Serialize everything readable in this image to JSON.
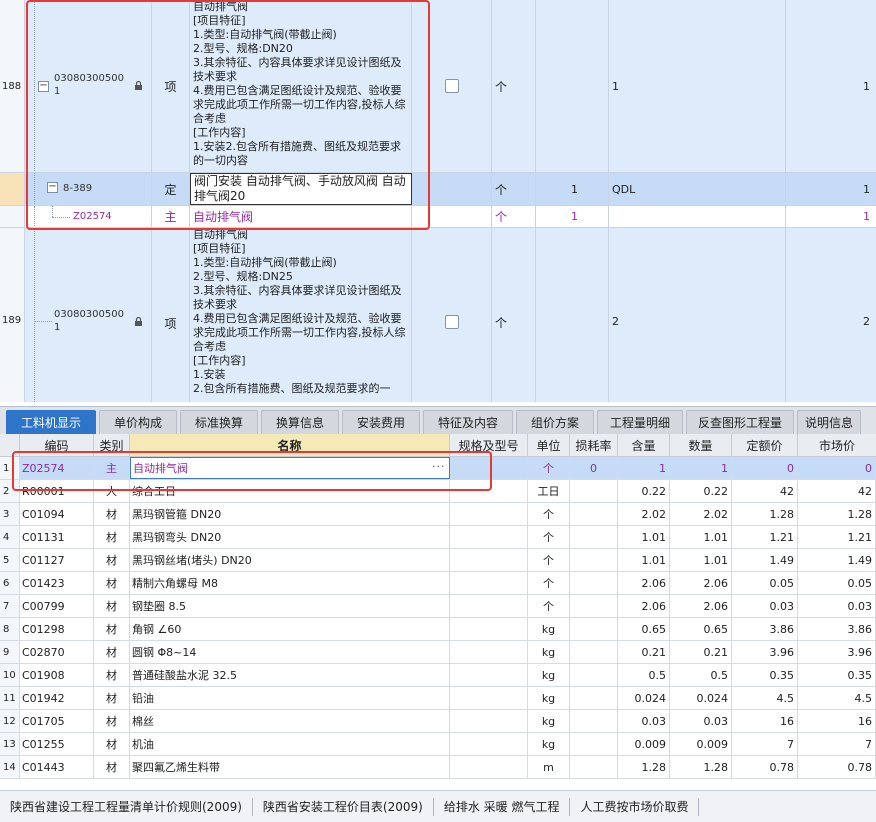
{
  "top_grid": {
    "rows": [
      {
        "num": "188",
        "code_line1": "03080300500",
        "code_line2": "1",
        "type": "项",
        "desc": "自动排气阀\n[项目特征]\n1.类型:自动排气阀(带截止阀)\n2.型号、规格:DN20\n3.其余特征、内容具体要求详见设计图纸及技术要求\n4.费用已包含满足图纸设计及规范、验收要求完成此项工作所需一切工作内容,投标人综合考虑\n[工作内容]\n1.安装2.包含所有措施费、图纸及规范要求的一切内容",
        "unit": "个",
        "qty": "",
        "expr": "1",
        "val": "1"
      },
      {
        "num": "",
        "code": "8-389",
        "type": "定",
        "desc": "阀门安装 自动排气阀、手动放风阀 自动排气阀20",
        "unit": "个",
        "qty": "1",
        "expr": "QDL",
        "val": "1"
      },
      {
        "num": "",
        "code": "Z02574",
        "type": "主",
        "desc": "自动排气阀",
        "unit": "个",
        "qty": "1",
        "expr": "",
        "val": "1"
      },
      {
        "num": "189",
        "code_line1": "03080300500",
        "code_line2": "1",
        "type": "项",
        "desc": "自动排气阀\n[项目特征]\n1.类型:自动排气阀(带截止阀)\n2.型号、规格:DN25\n3.其余特征、内容具体要求详见设计图纸及技术要求\n4.费用已包含满足图纸设计及规范、验收要求完成此项工作所需一切工作内容,投标人综合考虑\n[工作内容]\n1.安装\n2.包含所有措施费、图纸及规范要求的一",
        "unit": "个",
        "qty": "",
        "expr": "2",
        "val": "2"
      }
    ]
  },
  "tabs": [
    "工料机显示",
    "单价构成",
    "标准换算",
    "换算信息",
    "安装费用",
    "特征及内容",
    "组价方案",
    "工程量明细",
    "反查图形工程量",
    "说明信息"
  ],
  "bottom_table": {
    "headers": [
      "编码",
      "类别",
      "名称",
      "规格及型号",
      "单位",
      "损耗率",
      "含量",
      "数量",
      "定额价",
      "市场价"
    ],
    "rows": [
      {
        "no": "1",
        "code": "Z02574",
        "cat": "主",
        "name": "自动排气阀",
        "spec": "",
        "unit": "个",
        "loss": "0",
        "content": "1",
        "qty": "1",
        "quota": "0",
        "market": "0"
      },
      {
        "no": "2",
        "code": "R00001",
        "cat": "人",
        "name": "综合工日",
        "spec": "",
        "unit": "工日",
        "loss": "",
        "content": "0.22",
        "qty": "0.22",
        "quota": "42",
        "market": "42"
      },
      {
        "no": "3",
        "code": "C01094",
        "cat": "材",
        "name": "黑玛钢管箍 DN20",
        "spec": "",
        "unit": "个",
        "loss": "",
        "content": "2.02",
        "qty": "2.02",
        "quota": "1.28",
        "market": "1.28"
      },
      {
        "no": "4",
        "code": "C01131",
        "cat": "材",
        "name": "黑玛钢弯头 DN20",
        "spec": "",
        "unit": "个",
        "loss": "",
        "content": "1.01",
        "qty": "1.01",
        "quota": "1.21",
        "market": "1.21"
      },
      {
        "no": "5",
        "code": "C01127",
        "cat": "材",
        "name": "黑玛钢丝堵(堵头) DN20",
        "spec": "",
        "unit": "个",
        "loss": "",
        "content": "1.01",
        "qty": "1.01",
        "quota": "1.49",
        "market": "1.49"
      },
      {
        "no": "6",
        "code": "C01423",
        "cat": "材",
        "name": "精制六角螺母 M8",
        "spec": "",
        "unit": "个",
        "loss": "",
        "content": "2.06",
        "qty": "2.06",
        "quota": "0.05",
        "market": "0.05"
      },
      {
        "no": "7",
        "code": "C00799",
        "cat": "材",
        "name": "钢垫圈 8.5",
        "spec": "",
        "unit": "个",
        "loss": "",
        "content": "2.06",
        "qty": "2.06",
        "quota": "0.03",
        "market": "0.03"
      },
      {
        "no": "8",
        "code": "C01298",
        "cat": "材",
        "name": "角钢 ∠60",
        "spec": "",
        "unit": "kg",
        "loss": "",
        "content": "0.65",
        "qty": "0.65",
        "quota": "3.86",
        "market": "3.86"
      },
      {
        "no": "9",
        "code": "C02870",
        "cat": "材",
        "name": "圆钢 Φ8~14",
        "spec": "",
        "unit": "kg",
        "loss": "",
        "content": "0.21",
        "qty": "0.21",
        "quota": "3.96",
        "market": "3.96"
      },
      {
        "no": "10",
        "code": "C01908",
        "cat": "材",
        "name": "普通硅酸盐水泥 32.5",
        "spec": "",
        "unit": "kg",
        "loss": "",
        "content": "0.5",
        "qty": "0.5",
        "quota": "0.35",
        "market": "0.35"
      },
      {
        "no": "11",
        "code": "C01942",
        "cat": "材",
        "name": "铅油",
        "spec": "",
        "unit": "kg",
        "loss": "",
        "content": "0.024",
        "qty": "0.024",
        "quota": "4.5",
        "market": "4.5"
      },
      {
        "no": "12",
        "code": "C01705",
        "cat": "材",
        "name": "棉丝",
        "spec": "",
        "unit": "kg",
        "loss": "",
        "content": "0.03",
        "qty": "0.03",
        "quota": "16",
        "market": "16"
      },
      {
        "no": "13",
        "code": "C01255",
        "cat": "材",
        "name": "机油",
        "spec": "",
        "unit": "kg",
        "loss": "",
        "content": "0.009",
        "qty": "0.009",
        "quota": "7",
        "market": "7"
      },
      {
        "no": "14",
        "code": "C01443",
        "cat": "材",
        "name": "聚四氟乙烯生料带",
        "spec": "",
        "unit": "m",
        "loss": "",
        "content": "1.28",
        "qty": "1.28",
        "quota": "0.78",
        "market": "0.78"
      }
    ]
  },
  "status_bar": [
    "陕西省建设工程工程量清单计价规则(2009)",
    "陕西省安装工程价目表(2009)",
    "给排水 采暖 燃气工程",
    "人工费按市场价取费"
  ],
  "colors": {
    "accent": "#2e74c8",
    "highlight": "#e53935",
    "sub_text": "#9a2aa8"
  }
}
